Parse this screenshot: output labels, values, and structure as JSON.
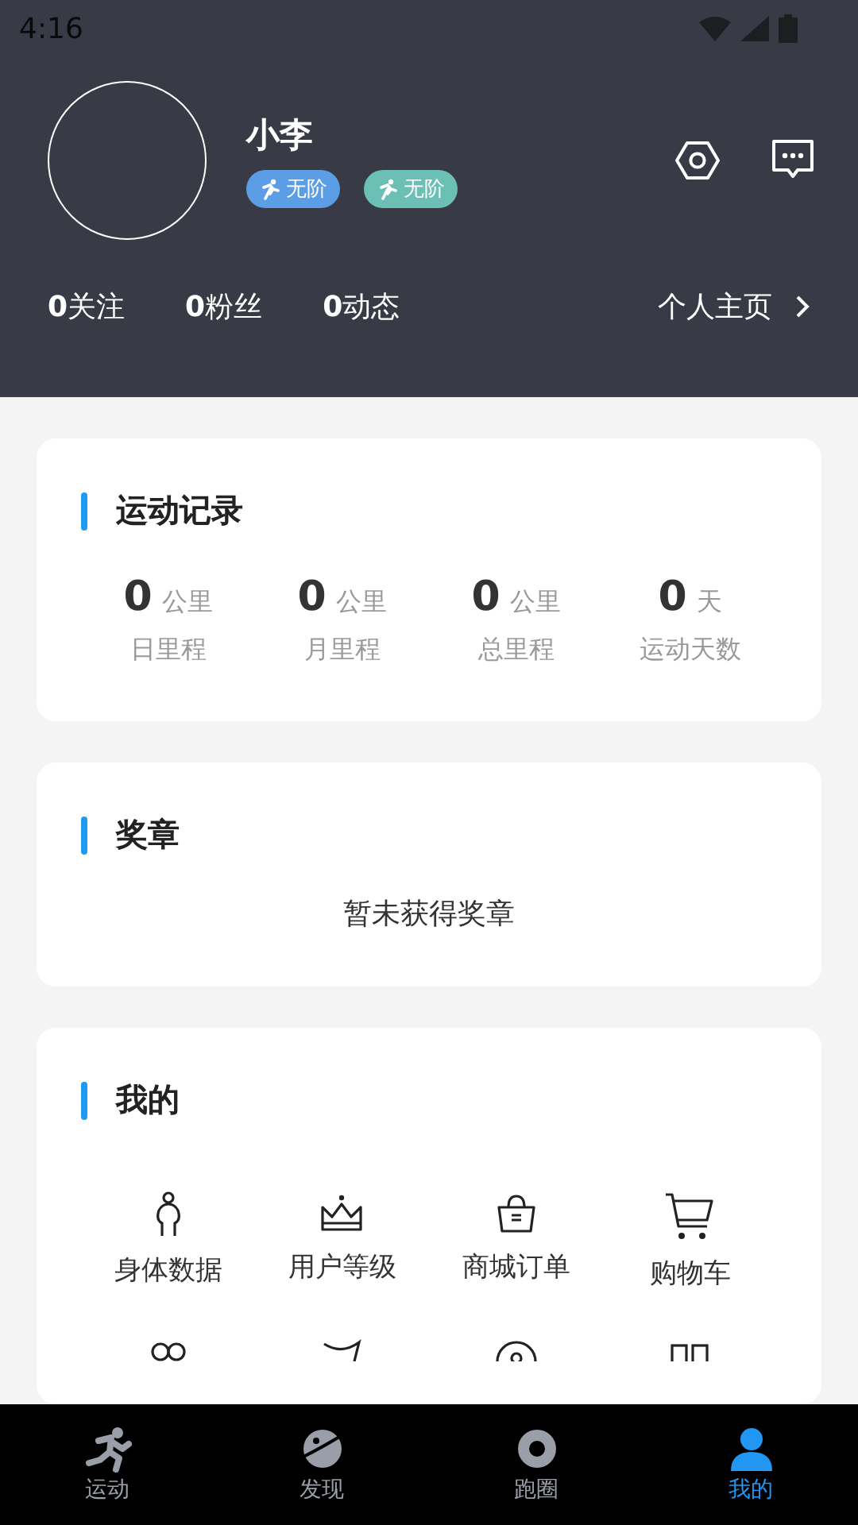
{
  "status_bar": {
    "time": "4:16"
  },
  "profile": {
    "name": "小李",
    "badges": [
      {
        "label": "无阶",
        "color": "#5b9ee6"
      },
      {
        "label": "无阶",
        "color": "#6bbfb5"
      }
    ]
  },
  "stats": [
    {
      "value": "0",
      "label": "关注"
    },
    {
      "value": "0",
      "label": "粉丝"
    },
    {
      "value": "0",
      "label": "动态"
    }
  ],
  "homepage_link": "个人主页",
  "sport_record": {
    "title": "运动记录",
    "items": [
      {
        "value": "0",
        "unit": "公里",
        "label": "日里程"
      },
      {
        "value": "0",
        "unit": "公里",
        "label": "月里程"
      },
      {
        "value": "0",
        "unit": "公里",
        "label": "总里程"
      },
      {
        "value": "0",
        "unit": "天",
        "label": "运动天数"
      }
    ]
  },
  "medals": {
    "title": "奖章",
    "empty_text": "暂未获得奖章"
  },
  "mine": {
    "title": "我的",
    "items": [
      {
        "label": "身体数据"
      },
      {
        "label": "用户等级"
      },
      {
        "label": "商城订单"
      },
      {
        "label": "购物车"
      }
    ]
  },
  "tabs": [
    {
      "label": "运动",
      "selected": false
    },
    {
      "label": "发现",
      "selected": false
    },
    {
      "label": "跑圈",
      "selected": false
    },
    {
      "label": "我的",
      "selected": true
    }
  ]
}
